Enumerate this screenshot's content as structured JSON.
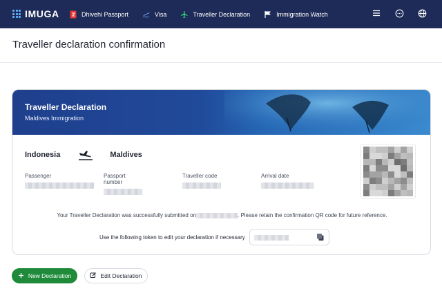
{
  "brand": {
    "name": "IMUGA"
  },
  "nav": {
    "items": [
      {
        "label": "Dhivehi Passport",
        "icon": "passport-icon"
      },
      {
        "label": "Visa",
        "icon": "visa-icon"
      },
      {
        "label": "Traveller Declaration",
        "icon": "plane-icon"
      },
      {
        "label": "Immigration Watch",
        "icon": "flag-icon"
      }
    ],
    "right_icons": [
      "menu-icon",
      "chat-icon",
      "globe-icon"
    ]
  },
  "page": {
    "title": "Traveller declaration confirmation"
  },
  "card": {
    "banner_title": "Traveller Declaration",
    "banner_subtitle": "Maldives Immigration",
    "route": {
      "from": "Indonesia",
      "to": "Maldives"
    },
    "fields": [
      {
        "label": "Passenger"
      },
      {
        "label": "Passport number"
      },
      {
        "label": "Traveller code"
      },
      {
        "label": "Arrival date"
      }
    ],
    "message_before": "Your Traveller Declaration was successfully submitted on",
    "message_after": ". Please retain the confirmation QR code for future reference.",
    "token_label": "Use the following token to edit your declaration if necessary"
  },
  "actions": {
    "new_label": "New Declaration",
    "edit_label": "Edit Declaration"
  },
  "colors": {
    "navbar": "#1e2a57",
    "accent_green": "#1e8a3a",
    "banner": "#1f3f8c"
  }
}
